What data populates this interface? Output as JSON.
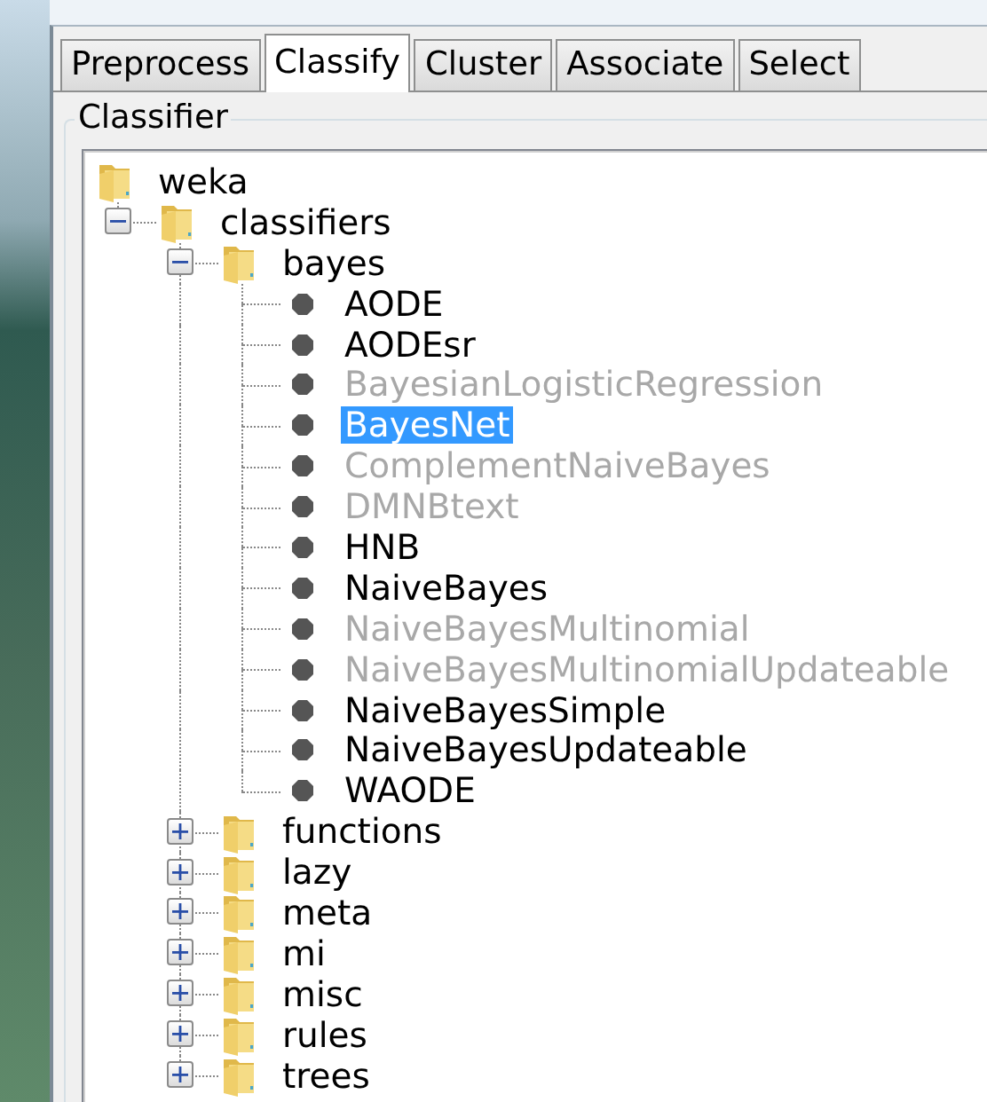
{
  "tabs": [
    {
      "label": "Preprocess",
      "selected": false
    },
    {
      "label": "Classify",
      "selected": true
    },
    {
      "label": "Cluster",
      "selected": false
    },
    {
      "label": "Associate",
      "selected": false
    },
    {
      "label": "Select",
      "selected": false
    }
  ],
  "classifier_group": {
    "title": "Classifier"
  },
  "tree": [
    {
      "kind": "folder",
      "label": "weka",
      "selected": false,
      "children": [
        {
          "kind": "folder",
          "label": "classifiers",
          "selected": false,
          "expanded": true,
          "children": [
            {
              "kind": "folder",
              "label": "bayes",
              "selected": false,
              "expanded": true,
              "children": [
                {
                  "kind": "leaf",
                  "label": "AODE",
                  "selected": false,
                  "disabled": false
                },
                {
                  "kind": "leaf",
                  "label": "AODEsr",
                  "selected": false,
                  "disabled": false
                },
                {
                  "kind": "leaf",
                  "label": "BayesianLogisticRegression",
                  "selected": false,
                  "disabled": true
                },
                {
                  "kind": "leaf",
                  "label": "BayesNet",
                  "selected": true,
                  "disabled": false
                },
                {
                  "kind": "leaf",
                  "label": "ComplementNaiveBayes",
                  "selected": false,
                  "disabled": true
                },
                {
                  "kind": "leaf",
                  "label": "DMNBtext",
                  "selected": false,
                  "disabled": true
                },
                {
                  "kind": "leaf",
                  "label": "HNB",
                  "selected": false,
                  "disabled": false
                },
                {
                  "kind": "leaf",
                  "label": "NaiveBayes",
                  "selected": false,
                  "disabled": false
                },
                {
                  "kind": "leaf",
                  "label": "NaiveBayesMultinomial",
                  "selected": false,
                  "disabled": true
                },
                {
                  "kind": "leaf",
                  "label": "NaiveBayesMultinomialUpdateable",
                  "selected": false,
                  "disabled": true
                },
                {
                  "kind": "leaf",
                  "label": "NaiveBayesSimple",
                  "selected": false,
                  "disabled": false
                },
                {
                  "kind": "leaf",
                  "label": "NaiveBayesUpdateable",
                  "selected": false,
                  "disabled": false
                },
                {
                  "kind": "leaf",
                  "label": "WAODE",
                  "selected": false,
                  "disabled": false
                }
              ]
            },
            {
              "kind": "folder",
              "label": "functions",
              "selected": false,
              "expanded": false
            },
            {
              "kind": "folder",
              "label": "lazy",
              "selected": false,
              "expanded": false
            },
            {
              "kind": "folder",
              "label": "meta",
              "selected": false,
              "expanded": false
            },
            {
              "kind": "folder",
              "label": "mi",
              "selected": false,
              "expanded": false
            },
            {
              "kind": "folder",
              "label": "misc",
              "selected": false,
              "expanded": false
            },
            {
              "kind": "folder",
              "label": "rules",
              "selected": false,
              "expanded": false
            },
            {
              "kind": "folder",
              "label": "trees",
              "selected": false,
              "expanded": false
            }
          ]
        }
      ]
    }
  ]
}
